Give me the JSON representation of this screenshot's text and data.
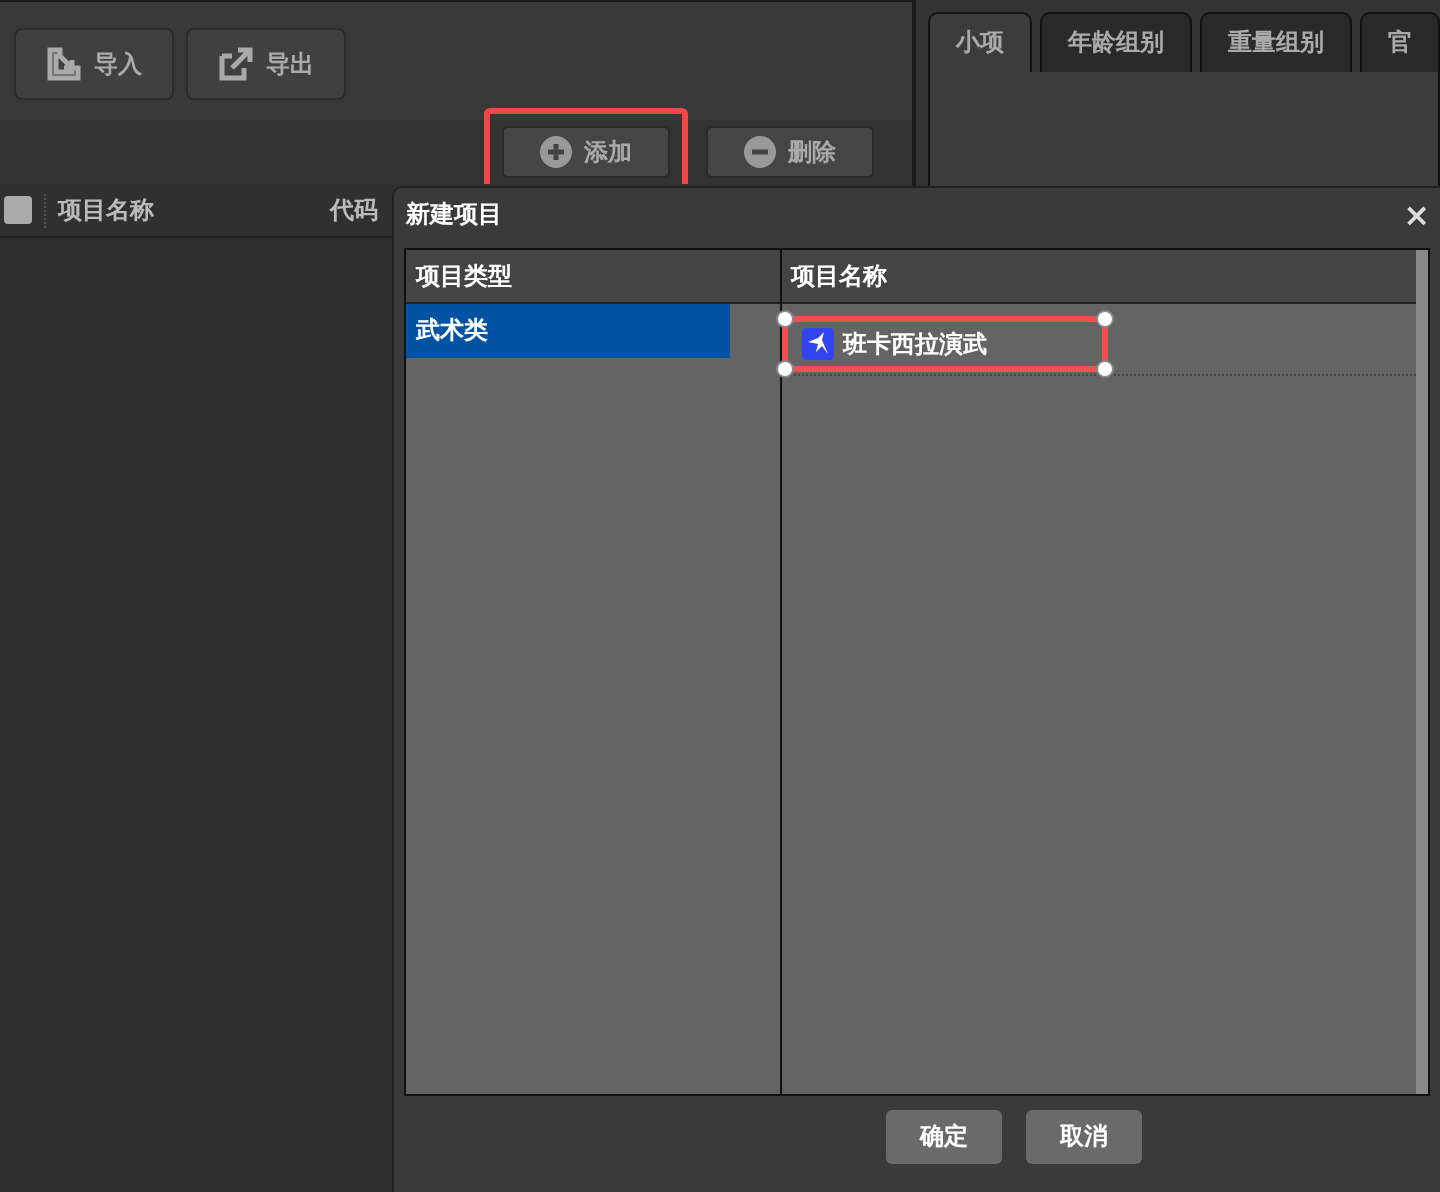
{
  "toolbar": [
    {
      "kind": "import",
      "label": "导入"
    },
    {
      "kind": "export",
      "label": "导出"
    }
  ],
  "actions": [
    {
      "kind": "add",
      "label": "添加",
      "highlighted": true
    },
    {
      "kind": "delete",
      "label": "删除",
      "highlighted": false
    }
  ],
  "table": {
    "checked": false,
    "columns": [
      "项目名称",
      "代码"
    ]
  },
  "tabs": [
    {
      "label": "小项",
      "selected": true
    },
    {
      "label": "年龄组别",
      "selected": false
    },
    {
      "label": "重量组别",
      "selected": false
    },
    {
      "label": "官",
      "selected": false
    }
  ],
  "dialog": {
    "title": "新建项目",
    "close": "×",
    "columns": [
      "项目类型",
      "项目名称"
    ],
    "types": [
      {
        "label": "武术类",
        "selected": true
      }
    ],
    "names": [
      {
        "label": "班卡西拉演武",
        "selected": true
      }
    ],
    "buttons": [
      "确定",
      "取消"
    ]
  }
}
